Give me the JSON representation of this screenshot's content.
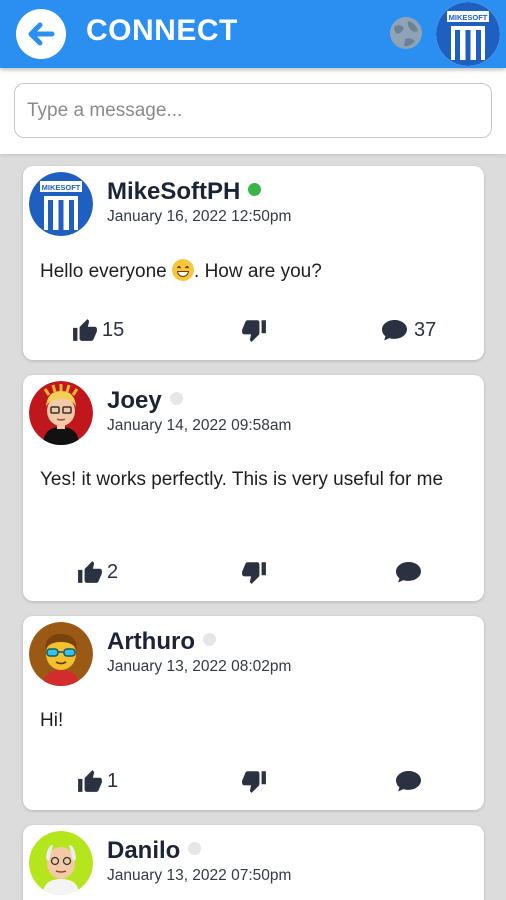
{
  "header": {
    "title": "CONNECT",
    "back_icon": "arrow-left-icon",
    "globe_icon": "globe-icon",
    "brand_logo_text": "MIKESOFT",
    "accent": "#2b8ff2"
  },
  "compose": {
    "placeholder": "Type a message..."
  },
  "posts": [
    {
      "name": "MikeSoftPH",
      "online": true,
      "status_color": "#3bb54a",
      "date": "January 16, 2022 12:50pm",
      "text_before_emoji": "Hello everyone ",
      "emoji": "grinning-face",
      "text_after_emoji": ". How are you?",
      "likes": "15",
      "comments": "37"
    },
    {
      "name": "Joey",
      "online": false,
      "status_color": "#e6e6e6",
      "date": "January 14, 2022 09:58am",
      "text": "Yes! it works perfectly. This is very useful for me",
      "likes": "2",
      "comments": ""
    },
    {
      "name": "Arthuro",
      "online": false,
      "status_color": "#e6e6e6",
      "date": "January 13, 2022 08:02pm",
      "text": "Hi!",
      "likes": "1",
      "comments": ""
    },
    {
      "name": "Danilo",
      "online": false,
      "status_color": "#e6e6e6",
      "date": "January 13, 2022 07:50pm"
    }
  ],
  "icons": {
    "like": "thumbs-up-icon",
    "dislike": "thumbs-down-icon",
    "comment": "comment-bubble-icon"
  }
}
